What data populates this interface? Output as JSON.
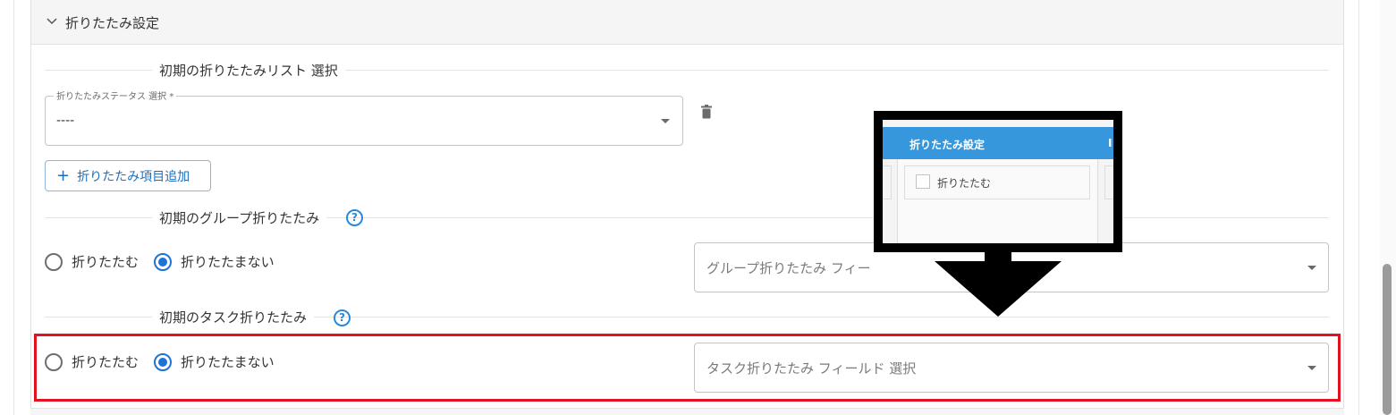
{
  "panel": {
    "title": "折りたたみ設定"
  },
  "list_section": {
    "heading": "初期の折りたたみリスト 選択",
    "status_field": {
      "legend": "折りたたみステータス 選択 *",
      "value": "----"
    },
    "add_button_label": "折りたたみ項目追加"
  },
  "group_section": {
    "heading": "初期のグループ折りたたみ",
    "help": "?",
    "options": [
      {
        "label": "折りたたむ",
        "checked": false
      },
      {
        "label": "折りたたまない",
        "checked": true
      }
    ],
    "field_placeholder": "グループ折りたたみ フィー"
  },
  "task_section": {
    "heading": "初期のタスク折りたたみ",
    "help": "?",
    "options": [
      {
        "label": "折りたたむ",
        "checked": false
      },
      {
        "label": "折りたたまない",
        "checked": true
      }
    ],
    "field_placeholder": "タスク折りたたみ フィールド 選択"
  },
  "overlay_preview": {
    "header_title": "折りたたみ設定",
    "checkbox_label": "折りたたむ"
  },
  "colors": {
    "accent": "#1e73d6",
    "highlight": "#e3121e",
    "preview_header": "#3797dc"
  }
}
